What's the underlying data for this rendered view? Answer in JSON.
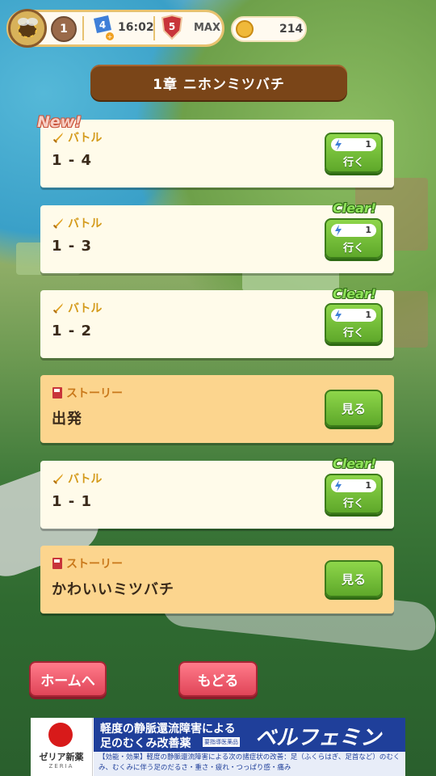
{
  "hud": {
    "level": "1",
    "stamina_level": "4",
    "stamina_time": "16:02",
    "rank": "5",
    "rank_status": "MAX",
    "coins": "214"
  },
  "chapter_title": "1章 ニホンミツバチ",
  "new_label": "New!",
  "clear_label": "Clear!",
  "go_label": "行く",
  "see_label": "見る",
  "cards": [
    {
      "kind": "バトル",
      "title": "1 - 4",
      "cost": "1",
      "status": "new"
    },
    {
      "kind": "バトル",
      "title": "1 - 3",
      "cost": "1",
      "status": "clear"
    },
    {
      "kind": "バトル",
      "title": "1 - 2",
      "cost": "1",
      "status": "clear"
    },
    {
      "kind": "ストーリー",
      "title": "出発"
    },
    {
      "kind": "バトル",
      "title": "1 - 1",
      "cost": "1",
      "status": "clear"
    },
    {
      "kind": "ストーリー",
      "title": "かわいいミツバチ"
    }
  ],
  "buttons": {
    "home": "ホームへ",
    "back": "もどる"
  },
  "ad": {
    "logo_name": "ゼリア新薬",
    "logo_sub": "ZERIA",
    "headline1": "軽度の静脈還流障害による",
    "headline2": "足のむくみ改善薬",
    "tag": "要指導医薬品",
    "brand": "ベルフェミン",
    "description": "【効能・効果】軽度の静脈還流障害による次の諸症状の改善：足（ふくらはぎ、足首など）のむくみ、むくみに伴う足のだるさ・重さ・疲れ・つっぱり感・痛み"
  },
  "colors": {
    "chapter_bg": "#7a4518",
    "battle_card": "#fffbea",
    "story_card": "#fcd58e",
    "green_button": "#6cbc34",
    "red_button": "#e95566",
    "clear_text": "#8fe35a",
    "ad_blue": "#1f3f9a"
  },
  "icons": {
    "avatar": "bee-avatar-icon",
    "stamina": "lightning-icon",
    "rank": "shield-icon",
    "coin": "coin-icon",
    "battle": "sword-icon",
    "story": "book-icon"
  }
}
